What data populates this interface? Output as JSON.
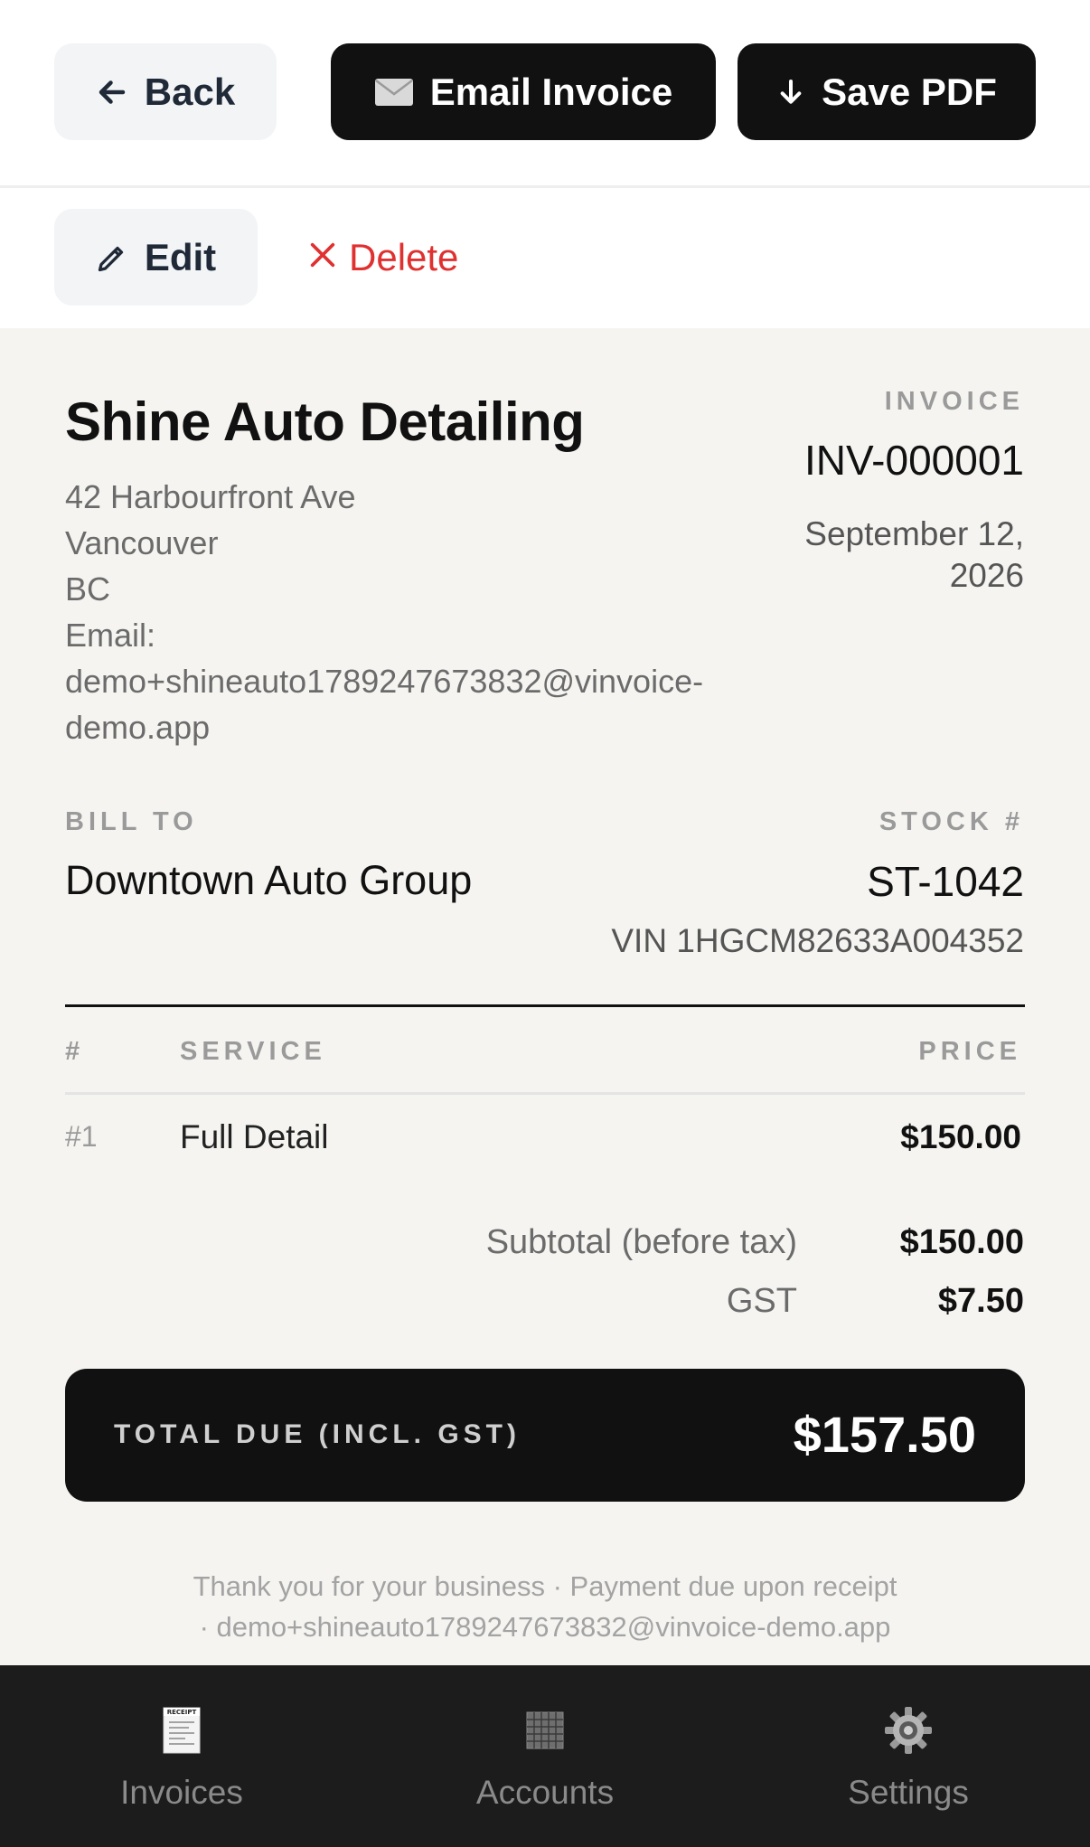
{
  "toolbar": {
    "back_label": "Back",
    "email_label": "Email Invoice",
    "pdf_label": "Save PDF"
  },
  "actions": {
    "edit_label": "Edit",
    "delete_label": "Delete"
  },
  "business": {
    "name": "Shine Auto Detailing",
    "address": "42 Harbourfront Ave",
    "city": "Vancouver",
    "province": "BC",
    "email_label": "Email:",
    "email_line1": "demo+shineauto1789247673832@vinvoice-",
    "email_line2": "demo.app"
  },
  "invoice": {
    "label": "INVOICE",
    "number": "INV-000001",
    "date_line1": "September 12,",
    "date_line2": "2026"
  },
  "bill_to": {
    "label": "BILL TO",
    "name": "Downtown Auto Group"
  },
  "vehicle": {
    "stock_label": "STOCK #",
    "stock": "ST-1042",
    "vin": "VIN 1HGCM82633A004352"
  },
  "table": {
    "headers": {
      "num": "#",
      "service": "SERVICE",
      "price": "PRICE"
    },
    "rows": [
      {
        "num": "#1",
        "service": "Full Detail",
        "price": "$150.00"
      }
    ]
  },
  "summary": {
    "subtotal_label": "Subtotal (before tax)",
    "subtotal": "$150.00",
    "tax_label": "GST",
    "tax": "$7.50",
    "total_label": "TOTAL DUE (INCL. GST)",
    "total": "$157.50"
  },
  "footer": {
    "line1": "Thank you for your business · Payment due upon receipt",
    "line2": "· demo+shineauto1789247673832@vinvoice-demo.app"
  },
  "nav": {
    "items": [
      {
        "label": "Invoices",
        "icon": "receipt-icon"
      },
      {
        "label": "Accounts",
        "icon": "grid-icon"
      },
      {
        "label": "Settings",
        "icon": "gear-icon"
      }
    ]
  },
  "colors": {
    "accent_dark": "#111111",
    "danger": "#e03131",
    "page_bg": "#f5f4f1"
  }
}
